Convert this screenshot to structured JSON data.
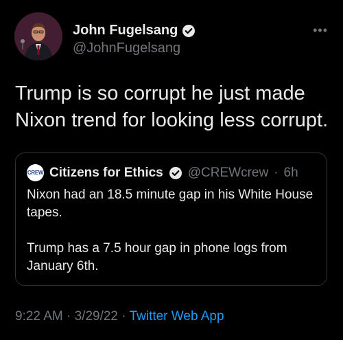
{
  "author": {
    "name": "John Fugelsang",
    "handle": "@JohnFugelsang",
    "verified": true
  },
  "tweet_text": "Trump is so corrupt he just made Nixon trend for looking less corrupt.",
  "quoted_tweet": {
    "avatar_text": "CREW",
    "name": "Citizens for Ethics",
    "handle": "@CREWcrew",
    "separator": "·",
    "time": "6h",
    "text": "Nixon had an 18.5 minute gap in his White House tapes.\n\nTrump has a 7.5 hour gap in phone logs from January 6th."
  },
  "footer": {
    "time": "9:22 AM",
    "separator": "·",
    "date": "3/29/22",
    "source": "Twitter Web App"
  },
  "more_icon": "more-dots-icon",
  "colors": {
    "background": "#000000",
    "text": "#e7e9ea",
    "muted": "#71767b",
    "link": "#1d9bf0",
    "border": "#2f3336"
  }
}
